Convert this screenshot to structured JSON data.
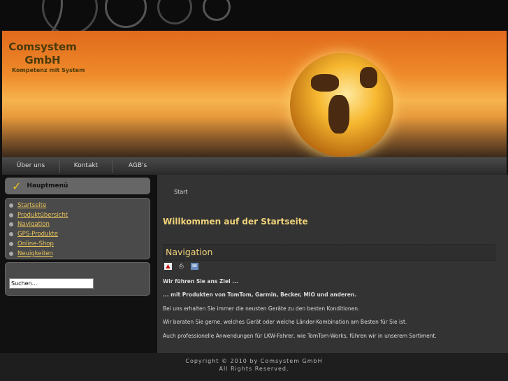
{
  "logo": {
    "name": "Comsystem GmbH",
    "tagline": "Kompetenz mit System"
  },
  "nav": [
    {
      "label": "Über uns"
    },
    {
      "label": "Kontakt"
    },
    {
      "label": "AGB's"
    }
  ],
  "sidebar": {
    "menu_title": "Hauptmenü",
    "items": [
      {
        "label": "Startseite"
      },
      {
        "label": "Produktübersicht"
      },
      {
        "label": "Navigation"
      },
      {
        "label": "GPS-Produkte"
      },
      {
        "label": "Online-Shop"
      },
      {
        "label": "Neuigkeiten"
      }
    ],
    "search_value": "Suchen..."
  },
  "main": {
    "breadcrumb": "Start",
    "heading": "Willkommen auf der Startseite",
    "article_title": "Navigation",
    "icons": [
      "pdf-icon",
      "print-icon",
      "email-icon"
    ],
    "paragraphs": [
      "Wir führen Sie ans Ziel ...",
      "... mit Produkten von TomTom, Garmin, Becker, MIO und anderen.",
      "Bei uns erhalten Sie immer die neusten Geräte zu den besten Konditionen.",
      "Wir beraten Sie gerne, welches Gerät oder welche Länder-Kombination am Besten für Sie ist.",
      "Auch professionelle Anwendungen für LKW-Fahrer, wie TomTom-Works, führen wir in unserem Sortiment."
    ]
  },
  "footer": {
    "copyright": "Copyright ©  2010 by Comsystem GmbH",
    "rights": "All Rights Reserved."
  }
}
